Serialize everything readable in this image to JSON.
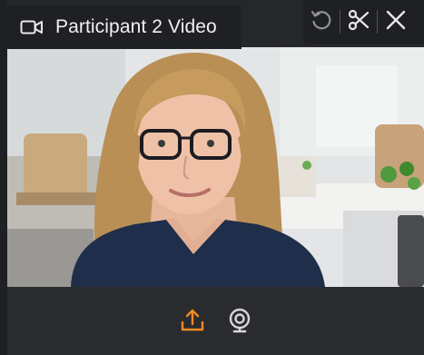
{
  "window": {
    "title": "Participant 2 Video",
    "title_icon": "video-camera-icon"
  },
  "toolbar": {
    "buttons": [
      {
        "name": "reset-button",
        "icon": "rotate-ccw-icon"
      },
      {
        "name": "scissors-button",
        "icon": "scissors-icon"
      },
      {
        "name": "close-button",
        "icon": "close-icon"
      }
    ]
  },
  "bottom_bar": {
    "buttons": [
      {
        "name": "upload-button",
        "icon": "upload-icon",
        "color": "#f08a24"
      },
      {
        "name": "webcam-button",
        "icon": "webcam-icon",
        "color": "#d7d7d7"
      }
    ]
  },
  "colors": {
    "accent": "#f08a24",
    "chrome": "#1f2023",
    "panel": "#2a2b2e"
  }
}
